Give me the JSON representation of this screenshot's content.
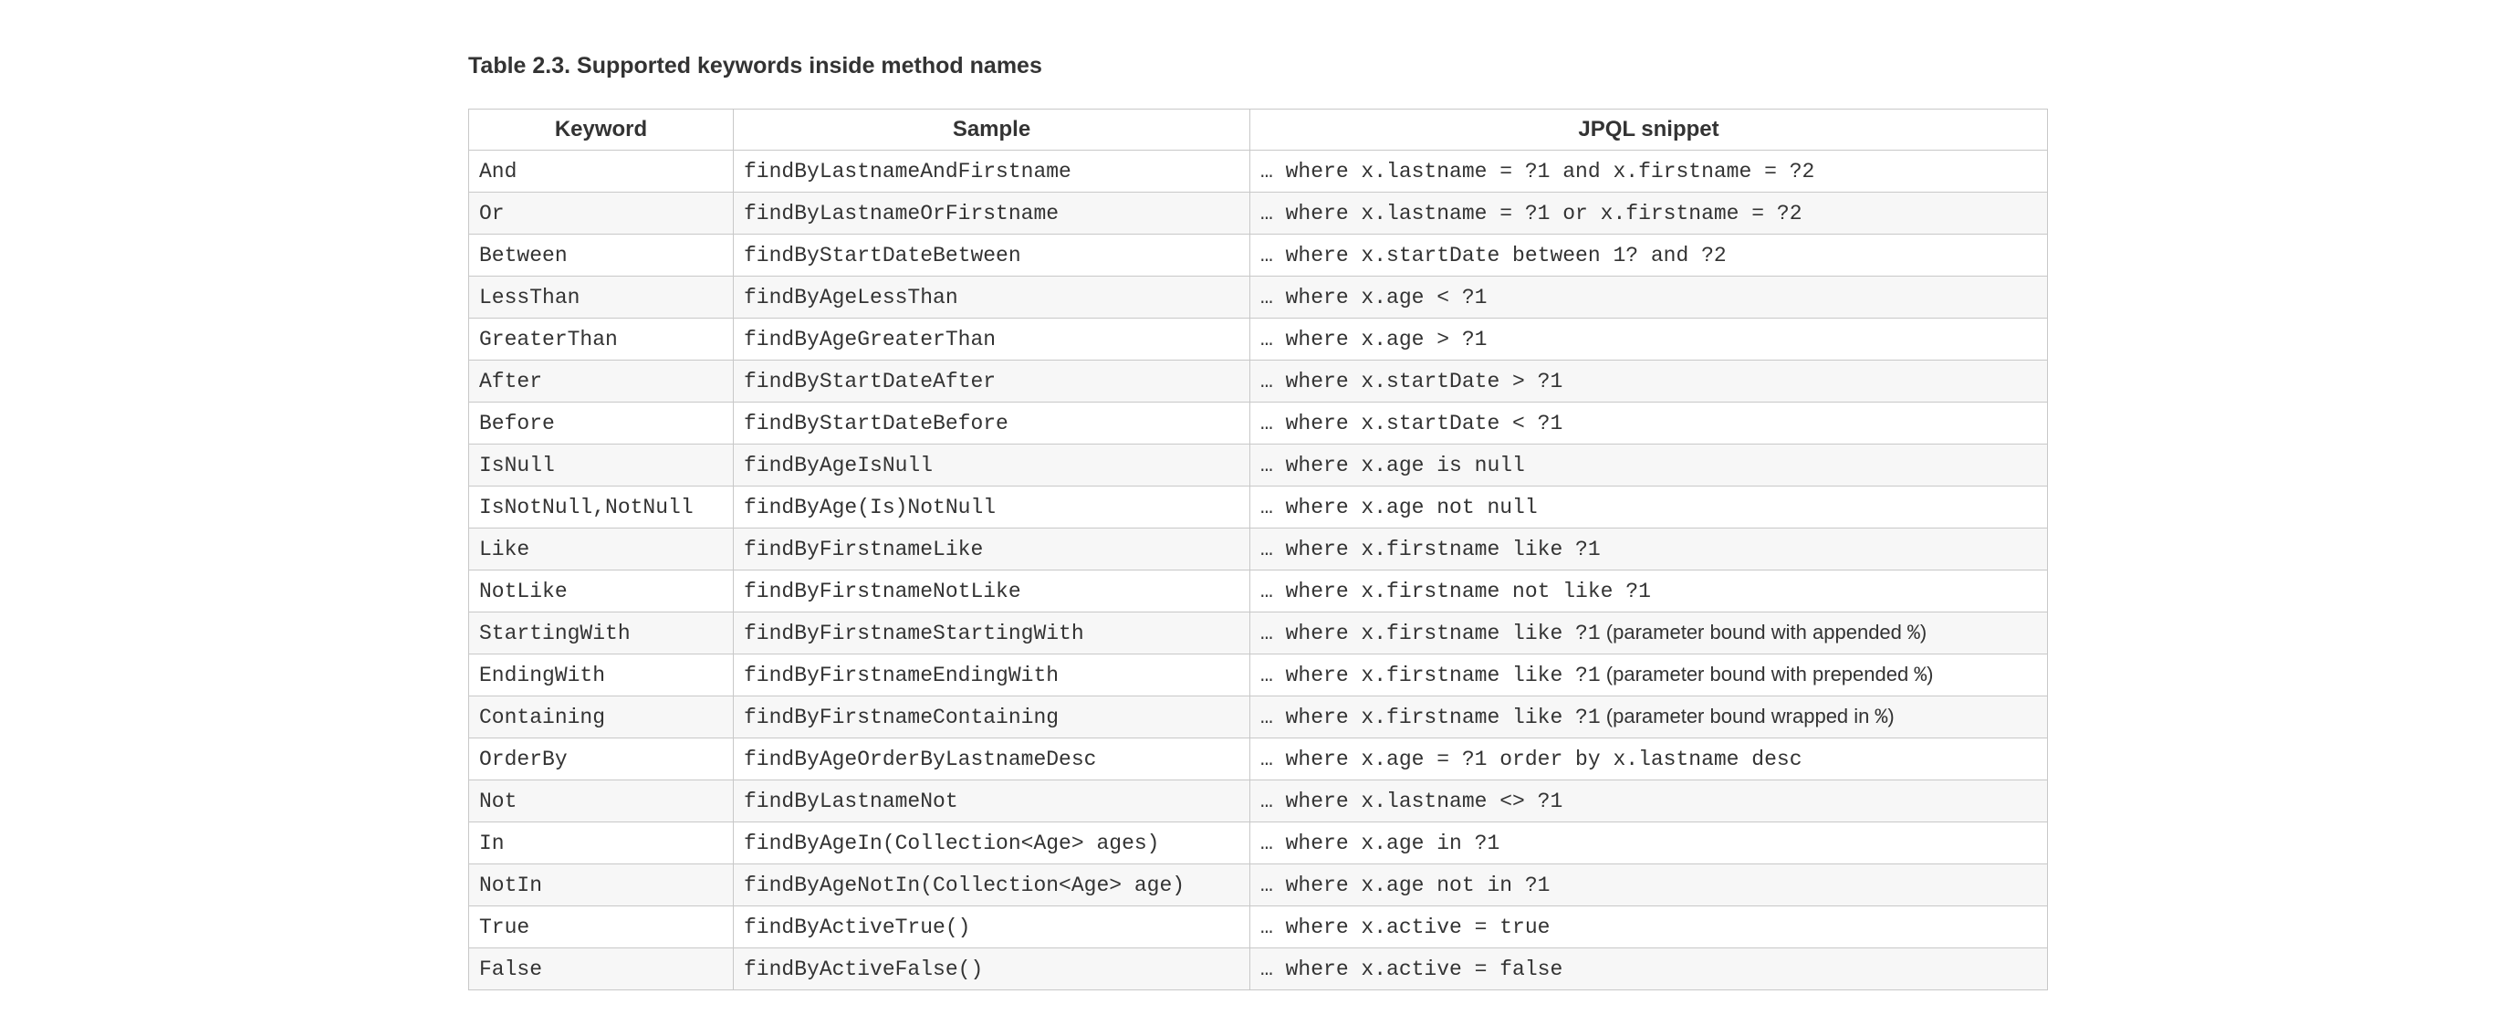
{
  "caption": "Table 2.3. Supported keywords inside method names",
  "columns": [
    "Keyword",
    "Sample",
    "JPQL snippet"
  ],
  "rows": [
    {
      "keyword": "And",
      "sample": "findByLastnameAndFirstname",
      "snippet": "… where x.lastname = ?1 and x.firstname = ?2"
    },
    {
      "keyword": "Or",
      "sample": "findByLastnameOrFirstname",
      "snippet": "… where x.lastname = ?1 or x.firstname = ?2"
    },
    {
      "keyword": "Between",
      "sample": "findByStartDateBetween",
      "snippet": "… where x.startDate between 1? and ?2"
    },
    {
      "keyword": "LessThan",
      "sample": "findByAgeLessThan",
      "snippet": "… where x.age < ?1"
    },
    {
      "keyword": "GreaterThan",
      "sample": "findByAgeGreaterThan",
      "snippet": "… where x.age > ?1"
    },
    {
      "keyword": "After",
      "sample": "findByStartDateAfter",
      "snippet": "… where x.startDate > ?1"
    },
    {
      "keyword": "Before",
      "sample": "findByStartDateBefore",
      "snippet": "… where x.startDate < ?1"
    },
    {
      "keyword": "IsNull",
      "sample": "findByAgeIsNull",
      "snippet": "… where x.age is null"
    },
    {
      "keyword": "IsNotNull,NotNull",
      "sample": "findByAge(Is)NotNull",
      "snippet": "… where x.age not null"
    },
    {
      "keyword": "Like",
      "sample": "findByFirstnameLike",
      "snippet": "… where x.firstname like ?1"
    },
    {
      "keyword": "NotLike",
      "sample": "findByFirstnameNotLike",
      "snippet": "… where x.firstname not like ?1"
    },
    {
      "keyword": "StartingWith",
      "sample": "findByFirstnameStartingWith",
      "snippet": "… where x.firstname like ?1",
      "note_pre": " (parameter bound with appended ",
      "note_code": "%",
      "note_post": ")"
    },
    {
      "keyword": "EndingWith",
      "sample": "findByFirstnameEndingWith",
      "snippet": "… where x.firstname like ?1",
      "note_pre": " (parameter bound with prepended ",
      "note_code": "%",
      "note_post": ")"
    },
    {
      "keyword": "Containing",
      "sample": "findByFirstnameContaining",
      "snippet": "… where x.firstname like ?1",
      "note_pre": " (parameter bound wrapped in ",
      "note_code": "%",
      "note_post": ")"
    },
    {
      "keyword": "OrderBy",
      "sample": "findByAgeOrderByLastnameDesc",
      "snippet": "… where x.age = ?1 order by x.lastname desc"
    },
    {
      "keyword": "Not",
      "sample": "findByLastnameNot",
      "snippet": "… where x.lastname <> ?1"
    },
    {
      "keyword": "In",
      "sample": "findByAgeIn(Collection<Age> ages)",
      "snippet": "… where x.age in ?1"
    },
    {
      "keyword": "NotIn",
      "sample": "findByAgeNotIn(Collection<Age> age)",
      "snippet": "… where x.age not in ?1"
    },
    {
      "keyword": "True",
      "sample": "findByActiveTrue()",
      "snippet": "… where x.active = true"
    },
    {
      "keyword": "False",
      "sample": "findByActiveFalse()",
      "snippet": "… where x.active = false"
    }
  ]
}
